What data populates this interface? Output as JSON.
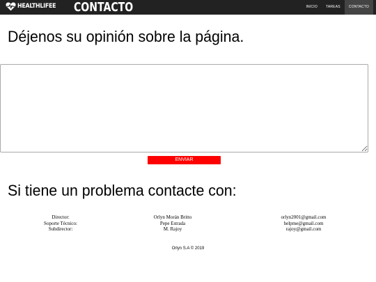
{
  "header": {
    "brand": "HEALTHLIFEE",
    "page_heading": "CONTACTO",
    "nav": [
      {
        "label": "INICIO",
        "active": false
      },
      {
        "label": "TAREAS",
        "active": false
      },
      {
        "label": "CONTACTO",
        "active": true
      }
    ]
  },
  "opinion": {
    "title": "Déjenos su opinión sobre la página.",
    "textarea_value": "",
    "send_label": "ENVIAR",
    "send_color": "#ff0000"
  },
  "contact": {
    "title": "Si tiene un problema contacte con:",
    "rows": [
      {
        "role": "Director:",
        "name": "Orlyn Morán Britto",
        "email": "orlyn2001@gmail.com"
      },
      {
        "role": "Soporte Técnico:",
        "name": "Pepe Estrada",
        "email": "helpme@gmail.com"
      },
      {
        "role": "Subdirector:",
        "name": "M. Rajoy",
        "email": "rajoy@gmail.com"
      }
    ]
  },
  "footer": {
    "text": "Orlyn S.A © 2019"
  },
  "colors": {
    "topbar": "#222222",
    "nav_active": "#444444",
    "button": "#ff0000"
  },
  "icons": {
    "logo": "heart-pulse-icon"
  }
}
